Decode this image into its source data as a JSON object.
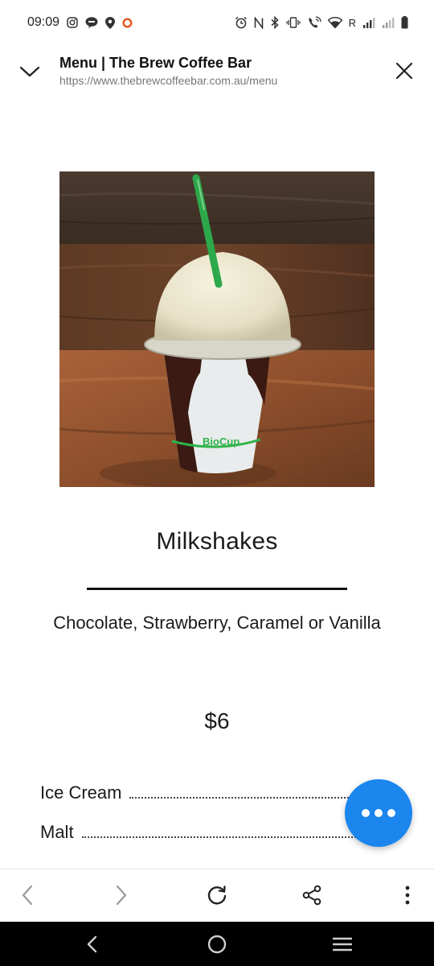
{
  "status_bar": {
    "time": "09:09",
    "carrier_letter": "R"
  },
  "header": {
    "title": "Menu | The Brew Coffee Bar",
    "url": "https://www.thebrewcoffeebar.com.au/menu"
  },
  "hero_image": {
    "description": "milkshake-cup-photo",
    "cup_brand": "BioCup"
  },
  "menu_item": {
    "name": "Milkshakes",
    "description": "Chocolate, Strawberry, Caramel or Vanilla",
    "price": "$6",
    "addons": [
      {
        "label": "Ice Cream"
      },
      {
        "label": "Malt"
      }
    ]
  },
  "colors": {
    "fab": "#1a86ee",
    "straw": "#2da84a"
  },
  "toolbar": {
    "icons": [
      "back-icon",
      "forward-icon",
      "reload-icon",
      "share-icon",
      "more-vertical-icon"
    ]
  },
  "nav_bar": {
    "icons": [
      "nav-back-icon",
      "nav-home-icon",
      "nav-recents-icon"
    ]
  }
}
